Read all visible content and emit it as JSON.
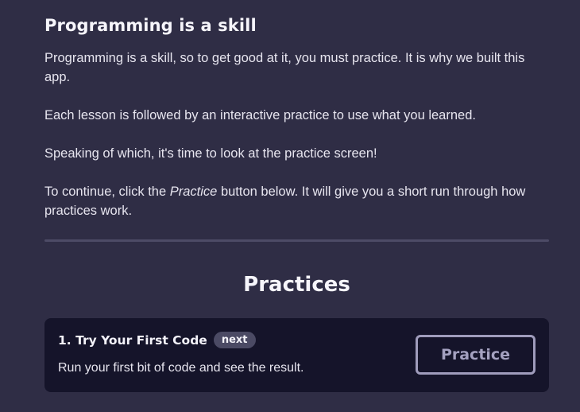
{
  "lesson": {
    "title": "Programming is a skill",
    "paragraphs": {
      "p1": "Programming is a skill, so to get good at it, you must practice. It is why we built this app.",
      "p2": "Each lesson is followed by an interactive practice to use what you learned.",
      "p3": "Speaking of which, it's time to look at the practice screen!",
      "p4_before": "To continue, click the ",
      "p4_em": "Practice",
      "p4_after": " button below. It will give you a short run through how practices work."
    }
  },
  "practices": {
    "heading": "Practices",
    "items": [
      {
        "title": "1. Try Your First Code",
        "badge": "next",
        "description": "Run your first bit of code and see the result.",
        "button_label": "Practice"
      }
    ]
  },
  "colors": {
    "background": "#2f2d45",
    "card_background": "#15142a",
    "badge_background": "#4b4a64",
    "button_border": "#9f9cbc",
    "divider": "#4d4b66"
  }
}
